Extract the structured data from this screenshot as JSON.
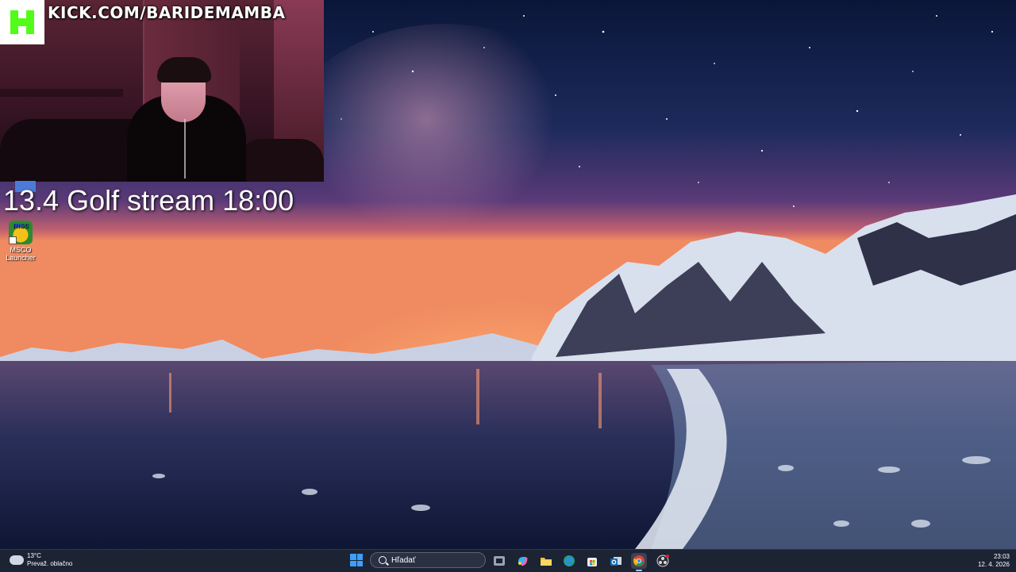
{
  "overlay": {
    "kick_url": "KICK.COM/BARIDEMAMBA",
    "stream_note": "13.4 Golf stream 18:00"
  },
  "desktop": {
    "icons": [
      {
        "label": "MSCO Launcher",
        "icon": "msco-launcher-icon"
      },
      {
        "label": "",
        "icon": "partially-hidden-shortcut-icon"
      }
    ]
  },
  "taskbar": {
    "weather": {
      "temp": "13°C",
      "condition": "Prevaž. oblačno"
    },
    "search_placeholder": "Hľadať",
    "apps": [
      {
        "name": "task-view",
        "active": false
      },
      {
        "name": "copilot",
        "active": false
      },
      {
        "name": "file-explorer",
        "active": false
      },
      {
        "name": "edge",
        "active": false
      },
      {
        "name": "microsoft-store",
        "active": false
      },
      {
        "name": "outlook",
        "active": false
      },
      {
        "name": "chrome",
        "active": true
      },
      {
        "name": "obs-studio",
        "active": false
      }
    ],
    "clock": {
      "time": "23:03",
      "date": "12. 4. 2026"
    }
  },
  "colors": {
    "kick_green": "#53fc18",
    "taskbar_bg": "#1c2333",
    "windows_blue": "#3aa0ff"
  }
}
